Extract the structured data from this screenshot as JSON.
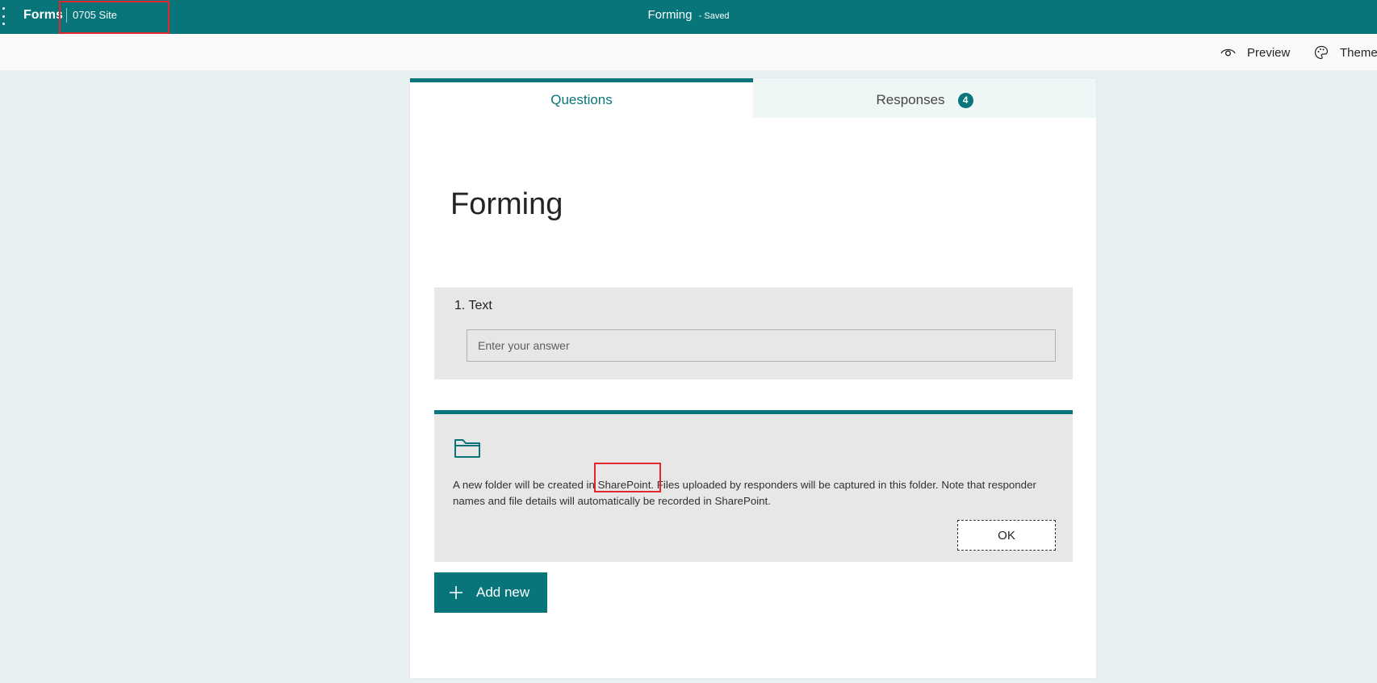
{
  "header": {
    "app_name": "Forms",
    "site_name": "0705 Site",
    "form_title": "Forming",
    "save_status": "Saved",
    "title_separator": "-"
  },
  "commands": {
    "preview_label": "Preview",
    "theme_label": "Theme",
    "preview_icon": "eye-icon",
    "theme_icon": "palette-icon"
  },
  "tabs": {
    "questions_label": "Questions",
    "responses_label": "Responses",
    "responses_count": "4"
  },
  "form": {
    "title": "Forming"
  },
  "question": {
    "label": "1. Text",
    "placeholder": "Enter your answer"
  },
  "upload_notice": {
    "icon": "folder-icon",
    "text_before": "A new folder will be created in ",
    "highlight": "SharePoint.",
    "text_after": " Files uploaded by responders will be captured in this folder. Note that responder names and file details will automatically be recorded in SharePoint.",
    "ok_label": "OK"
  },
  "add_new": {
    "label": "Add new",
    "icon": "plus-icon"
  },
  "colors": {
    "accent": "#077579",
    "highlight_box": "#e3262b",
    "page_bg": "#e9f0f1"
  }
}
